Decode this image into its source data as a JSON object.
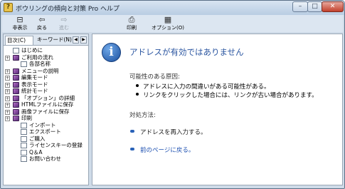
{
  "window": {
    "title": "ボウリングの傾向と対策 Pro ヘルプ",
    "controls": {
      "minimize": "–",
      "maximize": "□",
      "close": "✕"
    }
  },
  "toolbar": {
    "hide": "非表示",
    "back": "戻る",
    "forward": "進む",
    "print": "印刷",
    "options": "オプション(O)"
  },
  "tabs": {
    "contents": "目次(C)",
    "keyword": "キーワード(N)",
    "prev": "◀",
    "next": "▶"
  },
  "tree": [
    {
      "label": "はじめに",
      "type": "page",
      "level": 0,
      "expander": false
    },
    {
      "label": "ご利用の流れ",
      "type": "book",
      "level": 0,
      "expander": true
    },
    {
      "label": "各部名称",
      "type": "page",
      "level": 1,
      "expander": false
    },
    {
      "label": "メニューの説明",
      "type": "book",
      "level": 0,
      "expander": true
    },
    {
      "label": "編集モード",
      "type": "book",
      "level": 0,
      "expander": true
    },
    {
      "label": "表示モード",
      "type": "book",
      "level": 0,
      "expander": true
    },
    {
      "label": "統計モード",
      "type": "book",
      "level": 0,
      "expander": true
    },
    {
      "label": "「オプション」の詳細",
      "type": "book",
      "level": 0,
      "expander": true
    },
    {
      "label": "HTMLファイルに保存",
      "type": "book",
      "level": 0,
      "expander": true
    },
    {
      "label": "画像ファイルに保存",
      "type": "book",
      "level": 0,
      "expander": true
    },
    {
      "label": "印刷",
      "type": "book",
      "level": 0,
      "expander": true
    },
    {
      "label": "インポート",
      "type": "page",
      "level": 1,
      "expander": false
    },
    {
      "label": "エクスポート",
      "type": "page",
      "level": 1,
      "expander": false
    },
    {
      "label": "ご購入",
      "type": "page",
      "level": 1,
      "expander": false
    },
    {
      "label": "ライセンスキーの登録",
      "type": "page",
      "level": 1,
      "expander": false
    },
    {
      "label": "Q＆A",
      "type": "page",
      "level": 1,
      "expander": false
    },
    {
      "label": "お問い合わせ",
      "type": "page",
      "level": 1,
      "expander": false
    }
  ],
  "content": {
    "info_glyph": "i",
    "heading": "アドレスが有効ではありません",
    "causes_title": "可能性のある原因:",
    "causes": [
      "アドレスに入力の間違いがある可能性がある。",
      "リンクをクリックした場合には、リンクが古い場合があります。"
    ],
    "fix_title": "対処方法:",
    "actions": [
      "アドレスを再入力する。",
      "前のページに戻る。"
    ]
  },
  "colors": {
    "heading": "#2a55a0",
    "link": "#1c4fb0",
    "book_icon": "#8a4aa6"
  }
}
